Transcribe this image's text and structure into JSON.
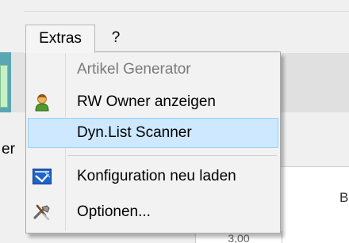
{
  "menubar": {
    "items": [
      {
        "label": "Extras"
      },
      {
        "label": "?"
      }
    ]
  },
  "extras_menu": {
    "items": [
      {
        "label": "Artikel Generator",
        "disabled": true,
        "icon": "none"
      },
      {
        "label": "RW Owner anzeigen",
        "disabled": false,
        "icon": "user-icon"
      },
      {
        "label": "Dyn.List Scanner",
        "disabled": false,
        "icon": "none",
        "highlighted": true
      },
      {
        "label": "Konfiguration neu laden",
        "disabled": false,
        "icon": "reload-config-icon"
      },
      {
        "label": "Optionen...",
        "disabled": false,
        "icon": "tools-icon"
      }
    ]
  },
  "background": {
    "fragment_left": "er",
    "fragment_right": "B",
    "fragment_bottom": "3,00"
  },
  "colors": {
    "highlight_fill": "#cde8ff",
    "highlight_border": "#99d1ff",
    "disabled_text": "#7a7a7a",
    "menu_bg": "#f2f2f2"
  }
}
